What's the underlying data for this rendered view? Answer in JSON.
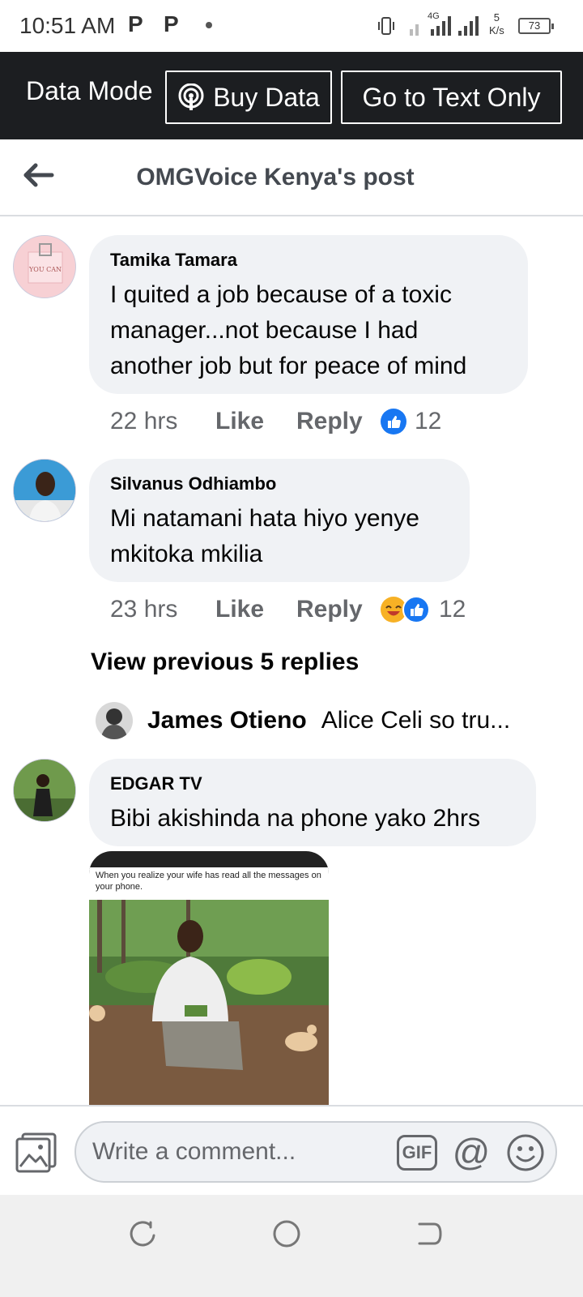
{
  "status_bar": {
    "time": "10:51 AM",
    "notif_1": "P",
    "notif_2": "P",
    "network": "4G",
    "speed_value": "5",
    "speed_unit": "K/s",
    "battery": "73"
  },
  "data_bar": {
    "label": "Data Mode",
    "buy_data": "Buy Data",
    "text_only": "Go to Text Only"
  },
  "header": {
    "title": "OMGVoice Kenya's post"
  },
  "comments": [
    {
      "author": "Tamika Tamara",
      "text": "I quited a job because of a toxic manager...not because I had another job but for peace of mind",
      "time": "22 hrs",
      "like": "Like",
      "reply": "Reply",
      "reaction_count": "12",
      "avatar_text": "YOU CAN"
    },
    {
      "author": "Silvanus Odhiambo",
      "text": "Mi natamani hata hiyo yenye mkitoka mkilia",
      "time": "23 hrs",
      "like": "Like",
      "reply": "Reply",
      "reaction_count": "12"
    },
    {
      "author": "EDGAR TV",
      "text": "Bibi akishinda na phone yako 2hrs",
      "photo_caption": "When you realize your wife has read all the messages on your phone."
    }
  ],
  "view_previous": "View previous 5 replies",
  "reply_preview": {
    "name": "James Otieno",
    "text": "Alice Celi so tru..."
  },
  "composer": {
    "placeholder": "Write a comment...",
    "gif": "GIF",
    "at": "@"
  },
  "colors": {
    "data_bar_bg": "#1c1e21",
    "bubble_bg": "#f0f2f5",
    "like_blue": "#1877f2",
    "meta_gray": "#65676b"
  }
}
